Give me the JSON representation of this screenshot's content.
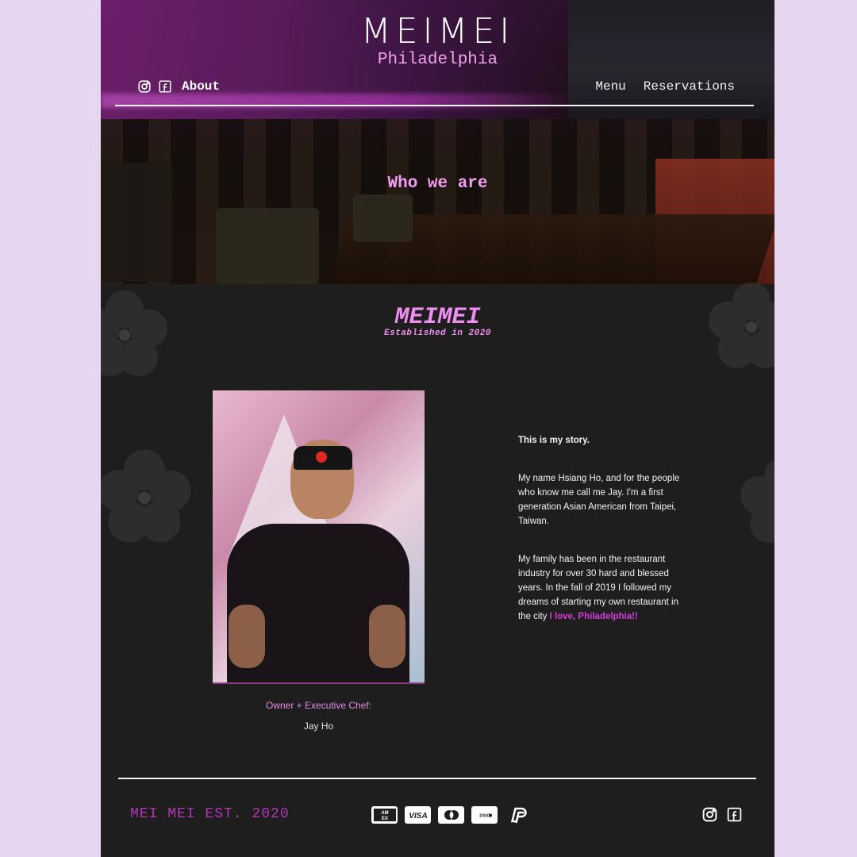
{
  "brand": {
    "title": "MEIMEI",
    "city": "Philadelphia"
  },
  "nav": {
    "left_icons": [
      "instagram-icon",
      "facebook-icon"
    ],
    "about": "About",
    "menu": "Menu",
    "reservations": "Reservations"
  },
  "hero": {
    "heading": "Who we are"
  },
  "story": {
    "logo_title": "MEIMEI",
    "logo_subtitle": "Established in 2020",
    "caption_role": "Owner + Executive Chef:",
    "caption_name": "Jay Ho",
    "lead": "This is my story.",
    "para1": "My name Hsiang Ho, and for the people who know me call me Jay. I'm a first generation Asian American from Taipei, Taiwan.",
    "para2_prefix": "My family has been in the restaurant industry for over 30 hard and blessed years. In the fall of 2019 I followed my dreams of starting my own restaurant in the city ",
    "para2_highlight": "I love, Philadelphia!!"
  },
  "footer": {
    "est": "MEI MEI EST. 2020",
    "payments": [
      "AMEX",
      "VISA",
      "MC",
      "DISCOVER",
      "PP"
    ],
    "social_icons": [
      "instagram-icon",
      "facebook-icon"
    ]
  },
  "colors": {
    "accent_pink": "#ef8ef0",
    "accent_magenta": "#d43cd6",
    "page_bg": "#1e1e1e",
    "outer_bg": "#e6d6ef"
  }
}
